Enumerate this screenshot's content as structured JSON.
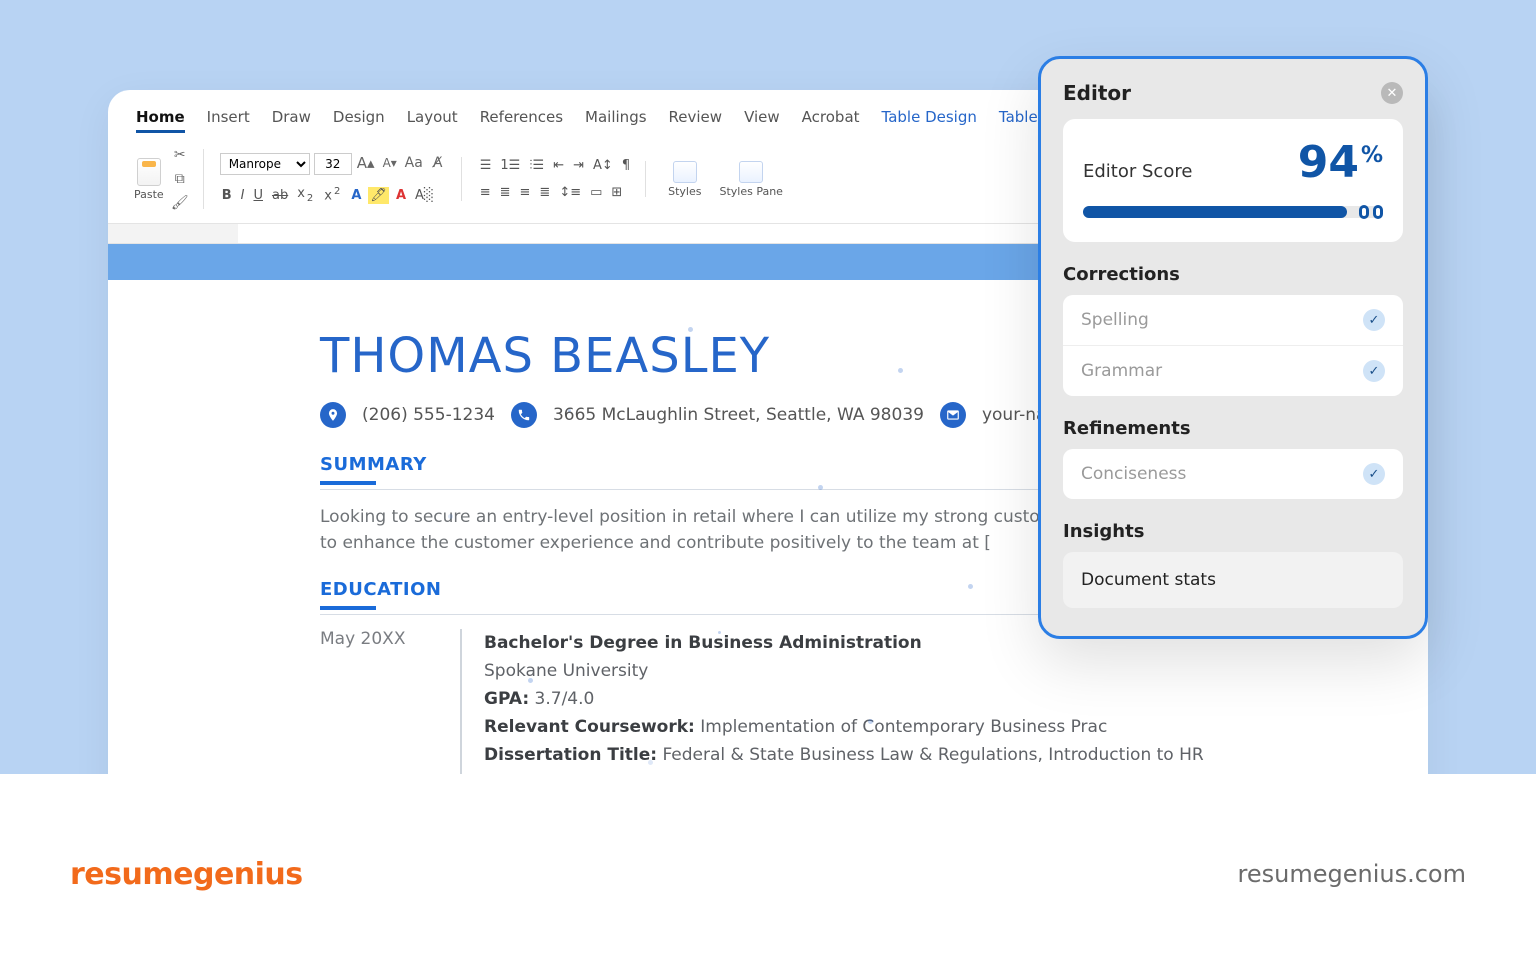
{
  "ribbon": {
    "tabs": [
      "Home",
      "Insert",
      "Draw",
      "Design",
      "Layout",
      "References",
      "Mailings",
      "Review",
      "View",
      "Acrobat"
    ],
    "contextTabs": [
      "Table Design",
      "Table Layout"
    ],
    "activeTab": "Home",
    "pasteLabel": "Paste",
    "fontName": "Manrope",
    "fontSize": "32",
    "stylesLabel": "Styles",
    "stylesPaneLabel": "Styles Pane"
  },
  "resume": {
    "name": "THOMAS BEASLEY",
    "phone": "(206) 555-1234",
    "address": "3665 McLaughlin Street, Seattle, WA 98039",
    "emailPartial": "your-nam",
    "summaryHeading": "SUMMARY",
    "summaryText": "Looking to secure an entry-level position in retail where I can utilize my strong customer se knowledge to enhance the customer experience and contribute positively to the team at [",
    "educationHeading": "EDUCATION",
    "educationDate": "May 20XX",
    "degree": "Bachelor's Degree in Business Administration",
    "university": "Spokane University",
    "gpaLabel": "GPA:",
    "gpaValue": " 3.7/4.0",
    "courseworkLabel": "Relevant Coursework:",
    "courseworkValue": " Implementation of Contemporary Business Prac",
    "dissertationLabel": "Dissertation Title:",
    "dissertationValue": " Federal & State Business Law & Regulations, Introduction to HR Theory & Practices, Company Diversity and Inclusion, Introduction to Employer Contract Law"
  },
  "editor": {
    "title": "Editor",
    "scoreLabel": "Editor Score",
    "scoreValue": "94",
    "scorePct": "%",
    "correctionsHeading": "Corrections",
    "corrections": [
      "Spelling",
      "Grammar"
    ],
    "refinementsHeading": "Refinements",
    "refinements": [
      "Conciseness"
    ],
    "insightsHeading": "Insights",
    "insightsItem": "Document stats"
  },
  "footer": {
    "logoResume": "resume",
    "logoGenius": "genius",
    "site": "resumegenius.com"
  }
}
